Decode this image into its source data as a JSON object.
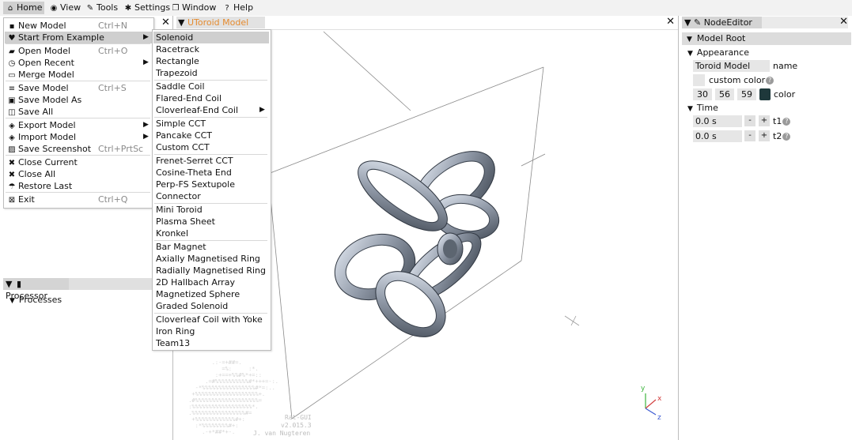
{
  "menubar": [
    {
      "label": "Home",
      "icon": "home-icon",
      "glyph": "⌂"
    },
    {
      "label": "View",
      "icon": "eye-icon",
      "glyph": "◉"
    },
    {
      "label": "Tools",
      "icon": "wrench-icon",
      "glyph": "✎"
    },
    {
      "label": "Settings",
      "icon": "gear-icon",
      "glyph": "✱"
    },
    {
      "label": "Window",
      "icon": "window-icon",
      "glyph": "❐"
    },
    {
      "label": "Help",
      "icon": "help-icon",
      "glyph": "?"
    }
  ],
  "home_menu": {
    "items": [
      {
        "label": "New Model",
        "shortcut": "Ctrl+N",
        "icon": "file-icon",
        "glyph": "▪"
      },
      {
        "label": "Start From Example",
        "shortcut": "",
        "icon": "heart-icon",
        "glyph": "♥",
        "submenu": true
      },
      {
        "label": "Open Model",
        "shortcut": "Ctrl+O",
        "icon": "folder-open-icon",
        "glyph": "▰"
      },
      {
        "label": "Open Recent",
        "shortcut": "",
        "icon": "clock-icon",
        "glyph": "◷",
        "submenu": true
      },
      {
        "label": "Merge Model",
        "shortcut": "",
        "icon": "folder-icon",
        "glyph": "▭"
      },
      {
        "label": "Save Model",
        "shortcut": "Ctrl+S",
        "icon": "database-icon",
        "glyph": "≡"
      },
      {
        "label": "Save Model As",
        "shortcut": "",
        "icon": "save-as-icon",
        "glyph": "▣"
      },
      {
        "label": "Save All",
        "shortcut": "",
        "icon": "save-all-icon",
        "glyph": "◫"
      },
      {
        "label": "Export Model",
        "shortcut": "",
        "icon": "export-icon",
        "glyph": "◈",
        "submenu": true
      },
      {
        "label": "Import Model",
        "shortcut": "",
        "icon": "import-icon",
        "glyph": "◈",
        "submenu": true
      },
      {
        "label": "Save Screenshot",
        "shortcut": "Ctrl+PrtSc",
        "icon": "image-icon",
        "glyph": "▨"
      },
      {
        "label": "Close Current",
        "shortcut": "",
        "icon": "close-icon",
        "glyph": "✖"
      },
      {
        "label": "Close All",
        "shortcut": "",
        "icon": "close-all-icon",
        "glyph": "✖"
      },
      {
        "label": "Restore Last",
        "shortcut": "",
        "icon": "umbrella-icon",
        "glyph": "☂"
      },
      {
        "label": "Exit",
        "shortcut": "Ctrl+Q",
        "icon": "exit-icon",
        "glyph": "⊠"
      }
    ]
  },
  "example_menu": {
    "items": [
      "Solenoid",
      "Racetrack",
      "Rectangle",
      "Trapezoid",
      "Saddle Coil",
      "Flared-End Coil",
      "Cloverleaf-End Coil",
      "Simple CCT",
      "Pancake CCT",
      "Custom CCT",
      "Frenet-Serret CCT",
      "Cosine-Theta End",
      "Perp-FS Sextupole",
      "Connector",
      "Mini Toroid",
      "Plasma Sheet",
      "Kronkel",
      "Bar Magnet",
      "Axially Magnetised Ring",
      "Radially Magnetised Ring",
      "2D Hallbach Array",
      "Magnetized Sphere",
      "Graded Solenoid",
      "Cloverleaf Coil with Yoke",
      "Iron Ring",
      "Team13"
    ]
  },
  "viewport": {
    "tab_label": "Toroid Model",
    "close": "✕"
  },
  "processor": {
    "tab_label": "Processor",
    "tree_item": "Processes"
  },
  "node_editor": {
    "tab_label": "NodeEditor",
    "close": "✕",
    "root": "Model Root",
    "appearance": "Appearance",
    "name_value": "Toroid Model",
    "name_label": "name",
    "custom_color_label": "custom color",
    "color_r": "30",
    "color_g": "56",
    "color_b": "59",
    "color_label": "color",
    "swatch_color": "#1e383b",
    "time": "Time",
    "t1_value": "0.0 s",
    "t1_label": "t1",
    "t2_value": "0.0 s",
    "t2_label": "t2",
    "minus": "-",
    "plus": "+"
  },
  "watermark": {
    "name": "Rat-GUI",
    "version": "v2.015.3",
    "author": "J. van Nugteren"
  },
  "axes": {
    "x": "x",
    "y": "y",
    "z": "z"
  },
  "accent": "#e58b2f",
  "ring_color": "#9aa3b1"
}
